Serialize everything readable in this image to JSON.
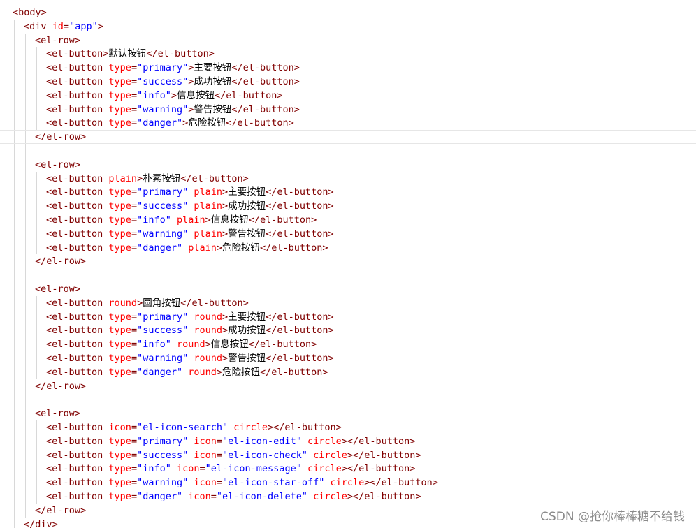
{
  "colors": {
    "tag": "#800000",
    "attr_name": "#ff0000",
    "attr_value": "#0000ff",
    "text": "#000000",
    "punct": "#800000",
    "guide": "#d8d8d8"
  },
  "code_lines": [
    {
      "indent": 0,
      "tokens": [
        {
          "t": "tag",
          "v": "<body>"
        }
      ]
    },
    {
      "indent": 1,
      "tokens": [
        {
          "t": "tag",
          "v": "<div"
        },
        {
          "t": "text",
          "v": " "
        },
        {
          "t": "attr_name",
          "v": "id"
        },
        {
          "t": "punct",
          "v": "="
        },
        {
          "t": "attr_value",
          "v": "\"app\""
        },
        {
          "t": "tag",
          "v": ">"
        }
      ]
    },
    {
      "indent": 2,
      "tokens": [
        {
          "t": "tag",
          "v": "<el-row>"
        }
      ]
    },
    {
      "indent": 3,
      "tokens": [
        {
          "t": "tag",
          "v": "<el-button>"
        },
        {
          "t": "text",
          "v": "默认按钮"
        },
        {
          "t": "tag",
          "v": "</el-button>"
        }
      ]
    },
    {
      "indent": 3,
      "tokens": [
        {
          "t": "tag",
          "v": "<el-button"
        },
        {
          "t": "text",
          "v": " "
        },
        {
          "t": "attr_name",
          "v": "type"
        },
        {
          "t": "punct",
          "v": "="
        },
        {
          "t": "attr_value",
          "v": "\"primary\""
        },
        {
          "t": "tag",
          "v": ">"
        },
        {
          "t": "text",
          "v": "主要按钮"
        },
        {
          "t": "tag",
          "v": "</el-button>"
        }
      ]
    },
    {
      "indent": 3,
      "tokens": [
        {
          "t": "tag",
          "v": "<el-button"
        },
        {
          "t": "text",
          "v": " "
        },
        {
          "t": "attr_name",
          "v": "type"
        },
        {
          "t": "punct",
          "v": "="
        },
        {
          "t": "attr_value",
          "v": "\"success\""
        },
        {
          "t": "tag",
          "v": ">"
        },
        {
          "t": "text",
          "v": "成功按钮"
        },
        {
          "t": "tag",
          "v": "</el-button>"
        }
      ]
    },
    {
      "indent": 3,
      "tokens": [
        {
          "t": "tag",
          "v": "<el-button"
        },
        {
          "t": "text",
          "v": " "
        },
        {
          "t": "attr_name",
          "v": "type"
        },
        {
          "t": "punct",
          "v": "="
        },
        {
          "t": "attr_value",
          "v": "\"info\""
        },
        {
          "t": "tag",
          "v": ">"
        },
        {
          "t": "text",
          "v": "信息按钮"
        },
        {
          "t": "tag",
          "v": "</el-button>"
        }
      ]
    },
    {
      "indent": 3,
      "tokens": [
        {
          "t": "tag",
          "v": "<el-button"
        },
        {
          "t": "text",
          "v": " "
        },
        {
          "t": "attr_name",
          "v": "type"
        },
        {
          "t": "punct",
          "v": "="
        },
        {
          "t": "attr_value",
          "v": "\"warning\""
        },
        {
          "t": "tag",
          "v": ">"
        },
        {
          "t": "text",
          "v": "警告按钮"
        },
        {
          "t": "tag",
          "v": "</el-button>"
        }
      ]
    },
    {
      "indent": 3,
      "tokens": [
        {
          "t": "tag",
          "v": "<el-button"
        },
        {
          "t": "text",
          "v": " "
        },
        {
          "t": "attr_name",
          "v": "type"
        },
        {
          "t": "punct",
          "v": "="
        },
        {
          "t": "attr_value",
          "v": "\"danger\""
        },
        {
          "t": "tag",
          "v": ">"
        },
        {
          "t": "text",
          "v": "危险按钮"
        },
        {
          "t": "tag",
          "v": "</el-button>"
        }
      ]
    },
    {
      "indent": 2,
      "current": true,
      "tokens": [
        {
          "t": "tag",
          "v": "</el-row>"
        }
      ]
    },
    {
      "indent": 2,
      "tokens": []
    },
    {
      "indent": 2,
      "tokens": [
        {
          "t": "tag",
          "v": "<el-row>"
        }
      ]
    },
    {
      "indent": 3,
      "tokens": [
        {
          "t": "tag",
          "v": "<el-button"
        },
        {
          "t": "text",
          "v": " "
        },
        {
          "t": "attr_name",
          "v": "plain"
        },
        {
          "t": "tag",
          "v": ">"
        },
        {
          "t": "text",
          "v": "朴素按钮"
        },
        {
          "t": "tag",
          "v": "</el-button>"
        }
      ]
    },
    {
      "indent": 3,
      "tokens": [
        {
          "t": "tag",
          "v": "<el-button"
        },
        {
          "t": "text",
          "v": " "
        },
        {
          "t": "attr_name",
          "v": "type"
        },
        {
          "t": "punct",
          "v": "="
        },
        {
          "t": "attr_value",
          "v": "\"primary\""
        },
        {
          "t": "text",
          "v": " "
        },
        {
          "t": "attr_name",
          "v": "plain"
        },
        {
          "t": "tag",
          "v": ">"
        },
        {
          "t": "text",
          "v": "主要按钮"
        },
        {
          "t": "tag",
          "v": "</el-button>"
        }
      ]
    },
    {
      "indent": 3,
      "tokens": [
        {
          "t": "tag",
          "v": "<el-button"
        },
        {
          "t": "text",
          "v": " "
        },
        {
          "t": "attr_name",
          "v": "type"
        },
        {
          "t": "punct",
          "v": "="
        },
        {
          "t": "attr_value",
          "v": "\"success\""
        },
        {
          "t": "text",
          "v": " "
        },
        {
          "t": "attr_name",
          "v": "plain"
        },
        {
          "t": "tag",
          "v": ">"
        },
        {
          "t": "text",
          "v": "成功按钮"
        },
        {
          "t": "tag",
          "v": "</el-button>"
        }
      ]
    },
    {
      "indent": 3,
      "tokens": [
        {
          "t": "tag",
          "v": "<el-button"
        },
        {
          "t": "text",
          "v": " "
        },
        {
          "t": "attr_name",
          "v": "type"
        },
        {
          "t": "punct",
          "v": "="
        },
        {
          "t": "attr_value",
          "v": "\"info\""
        },
        {
          "t": "text",
          "v": " "
        },
        {
          "t": "attr_name",
          "v": "plain"
        },
        {
          "t": "tag",
          "v": ">"
        },
        {
          "t": "text",
          "v": "信息按钮"
        },
        {
          "t": "tag",
          "v": "</el-button>"
        }
      ]
    },
    {
      "indent": 3,
      "tokens": [
        {
          "t": "tag",
          "v": "<el-button"
        },
        {
          "t": "text",
          "v": " "
        },
        {
          "t": "attr_name",
          "v": "type"
        },
        {
          "t": "punct",
          "v": "="
        },
        {
          "t": "attr_value",
          "v": "\"warning\""
        },
        {
          "t": "text",
          "v": " "
        },
        {
          "t": "attr_name",
          "v": "plain"
        },
        {
          "t": "tag",
          "v": ">"
        },
        {
          "t": "text",
          "v": "警告按钮"
        },
        {
          "t": "tag",
          "v": "</el-button>"
        }
      ]
    },
    {
      "indent": 3,
      "tokens": [
        {
          "t": "tag",
          "v": "<el-button"
        },
        {
          "t": "text",
          "v": " "
        },
        {
          "t": "attr_name",
          "v": "type"
        },
        {
          "t": "punct",
          "v": "="
        },
        {
          "t": "attr_value",
          "v": "\"danger\""
        },
        {
          "t": "text",
          "v": " "
        },
        {
          "t": "attr_name",
          "v": "plain"
        },
        {
          "t": "tag",
          "v": ">"
        },
        {
          "t": "text",
          "v": "危险按钮"
        },
        {
          "t": "tag",
          "v": "</el-button>"
        }
      ]
    },
    {
      "indent": 2,
      "tokens": [
        {
          "t": "tag",
          "v": "</el-row>"
        }
      ]
    },
    {
      "indent": 2,
      "tokens": []
    },
    {
      "indent": 2,
      "tokens": [
        {
          "t": "tag",
          "v": "<el-row>"
        }
      ]
    },
    {
      "indent": 3,
      "tokens": [
        {
          "t": "tag",
          "v": "<el-button"
        },
        {
          "t": "text",
          "v": " "
        },
        {
          "t": "attr_name",
          "v": "round"
        },
        {
          "t": "tag",
          "v": ">"
        },
        {
          "t": "text",
          "v": "圆角按钮"
        },
        {
          "t": "tag",
          "v": "</el-button>"
        }
      ]
    },
    {
      "indent": 3,
      "tokens": [
        {
          "t": "tag",
          "v": "<el-button"
        },
        {
          "t": "text",
          "v": " "
        },
        {
          "t": "attr_name",
          "v": "type"
        },
        {
          "t": "punct",
          "v": "="
        },
        {
          "t": "attr_value",
          "v": "\"primary\""
        },
        {
          "t": "text",
          "v": " "
        },
        {
          "t": "attr_name",
          "v": "round"
        },
        {
          "t": "tag",
          "v": ">"
        },
        {
          "t": "text",
          "v": "主要按钮"
        },
        {
          "t": "tag",
          "v": "</el-button>"
        }
      ]
    },
    {
      "indent": 3,
      "tokens": [
        {
          "t": "tag",
          "v": "<el-button"
        },
        {
          "t": "text",
          "v": " "
        },
        {
          "t": "attr_name",
          "v": "type"
        },
        {
          "t": "punct",
          "v": "="
        },
        {
          "t": "attr_value",
          "v": "\"success\""
        },
        {
          "t": "text",
          "v": " "
        },
        {
          "t": "attr_name",
          "v": "round"
        },
        {
          "t": "tag",
          "v": ">"
        },
        {
          "t": "text",
          "v": "成功按钮"
        },
        {
          "t": "tag",
          "v": "</el-button>"
        }
      ]
    },
    {
      "indent": 3,
      "tokens": [
        {
          "t": "tag",
          "v": "<el-button"
        },
        {
          "t": "text",
          "v": " "
        },
        {
          "t": "attr_name",
          "v": "type"
        },
        {
          "t": "punct",
          "v": "="
        },
        {
          "t": "attr_value",
          "v": "\"info\""
        },
        {
          "t": "text",
          "v": " "
        },
        {
          "t": "attr_name",
          "v": "round"
        },
        {
          "t": "tag",
          "v": ">"
        },
        {
          "t": "text",
          "v": "信息按钮"
        },
        {
          "t": "tag",
          "v": "</el-button>"
        }
      ]
    },
    {
      "indent": 3,
      "tokens": [
        {
          "t": "tag",
          "v": "<el-button"
        },
        {
          "t": "text",
          "v": " "
        },
        {
          "t": "attr_name",
          "v": "type"
        },
        {
          "t": "punct",
          "v": "="
        },
        {
          "t": "attr_value",
          "v": "\"warning\""
        },
        {
          "t": "text",
          "v": " "
        },
        {
          "t": "attr_name",
          "v": "round"
        },
        {
          "t": "tag",
          "v": ">"
        },
        {
          "t": "text",
          "v": "警告按钮"
        },
        {
          "t": "tag",
          "v": "</el-button>"
        }
      ]
    },
    {
      "indent": 3,
      "tokens": [
        {
          "t": "tag",
          "v": "<el-button"
        },
        {
          "t": "text",
          "v": " "
        },
        {
          "t": "attr_name",
          "v": "type"
        },
        {
          "t": "punct",
          "v": "="
        },
        {
          "t": "attr_value",
          "v": "\"danger\""
        },
        {
          "t": "text",
          "v": " "
        },
        {
          "t": "attr_name",
          "v": "round"
        },
        {
          "t": "tag",
          "v": ">"
        },
        {
          "t": "text",
          "v": "危险按钮"
        },
        {
          "t": "tag",
          "v": "</el-button>"
        }
      ]
    },
    {
      "indent": 2,
      "tokens": [
        {
          "t": "tag",
          "v": "</el-row>"
        }
      ]
    },
    {
      "indent": 2,
      "tokens": []
    },
    {
      "indent": 2,
      "tokens": [
        {
          "t": "tag",
          "v": "<el-row>"
        }
      ]
    },
    {
      "indent": 3,
      "tokens": [
        {
          "t": "tag",
          "v": "<el-button"
        },
        {
          "t": "text",
          "v": " "
        },
        {
          "t": "attr_name",
          "v": "icon"
        },
        {
          "t": "punct",
          "v": "="
        },
        {
          "t": "attr_value",
          "v": "\"el-icon-search\""
        },
        {
          "t": "text",
          "v": " "
        },
        {
          "t": "attr_name",
          "v": "circle"
        },
        {
          "t": "tag",
          "v": "></el-button>"
        }
      ]
    },
    {
      "indent": 3,
      "tokens": [
        {
          "t": "tag",
          "v": "<el-button"
        },
        {
          "t": "text",
          "v": " "
        },
        {
          "t": "attr_name",
          "v": "type"
        },
        {
          "t": "punct",
          "v": "="
        },
        {
          "t": "attr_value",
          "v": "\"primary\""
        },
        {
          "t": "text",
          "v": " "
        },
        {
          "t": "attr_name",
          "v": "icon"
        },
        {
          "t": "punct",
          "v": "="
        },
        {
          "t": "attr_value",
          "v": "\"el-icon-edit\""
        },
        {
          "t": "text",
          "v": " "
        },
        {
          "t": "attr_name",
          "v": "circle"
        },
        {
          "t": "tag",
          "v": "></el-button>"
        }
      ]
    },
    {
      "indent": 3,
      "tokens": [
        {
          "t": "tag",
          "v": "<el-button"
        },
        {
          "t": "text",
          "v": " "
        },
        {
          "t": "attr_name",
          "v": "type"
        },
        {
          "t": "punct",
          "v": "="
        },
        {
          "t": "attr_value",
          "v": "\"success\""
        },
        {
          "t": "text",
          "v": " "
        },
        {
          "t": "attr_name",
          "v": "icon"
        },
        {
          "t": "punct",
          "v": "="
        },
        {
          "t": "attr_value",
          "v": "\"el-icon-check\""
        },
        {
          "t": "text",
          "v": " "
        },
        {
          "t": "attr_name",
          "v": "circle"
        },
        {
          "t": "tag",
          "v": "></el-button>"
        }
      ]
    },
    {
      "indent": 3,
      "tokens": [
        {
          "t": "tag",
          "v": "<el-button"
        },
        {
          "t": "text",
          "v": " "
        },
        {
          "t": "attr_name",
          "v": "type"
        },
        {
          "t": "punct",
          "v": "="
        },
        {
          "t": "attr_value",
          "v": "\"info\""
        },
        {
          "t": "text",
          "v": " "
        },
        {
          "t": "attr_name",
          "v": "icon"
        },
        {
          "t": "punct",
          "v": "="
        },
        {
          "t": "attr_value",
          "v": "\"el-icon-message\""
        },
        {
          "t": "text",
          "v": " "
        },
        {
          "t": "attr_name",
          "v": "circle"
        },
        {
          "t": "tag",
          "v": "></el-button>"
        }
      ]
    },
    {
      "indent": 3,
      "tokens": [
        {
          "t": "tag",
          "v": "<el-button"
        },
        {
          "t": "text",
          "v": " "
        },
        {
          "t": "attr_name",
          "v": "type"
        },
        {
          "t": "punct",
          "v": "="
        },
        {
          "t": "attr_value",
          "v": "\"warning\""
        },
        {
          "t": "text",
          "v": " "
        },
        {
          "t": "attr_name",
          "v": "icon"
        },
        {
          "t": "punct",
          "v": "="
        },
        {
          "t": "attr_value",
          "v": "\"el-icon-star-off\""
        },
        {
          "t": "text",
          "v": " "
        },
        {
          "t": "attr_name",
          "v": "circle"
        },
        {
          "t": "tag",
          "v": "></el-button>"
        }
      ]
    },
    {
      "indent": 3,
      "tokens": [
        {
          "t": "tag",
          "v": "<el-button"
        },
        {
          "t": "text",
          "v": " "
        },
        {
          "t": "attr_name",
          "v": "type"
        },
        {
          "t": "punct",
          "v": "="
        },
        {
          "t": "attr_value",
          "v": "\"danger\""
        },
        {
          "t": "text",
          "v": " "
        },
        {
          "t": "attr_name",
          "v": "icon"
        },
        {
          "t": "punct",
          "v": "="
        },
        {
          "t": "attr_value",
          "v": "\"el-icon-delete\""
        },
        {
          "t": "text",
          "v": " "
        },
        {
          "t": "attr_name",
          "v": "circle"
        },
        {
          "t": "tag",
          "v": "></el-button>"
        }
      ]
    },
    {
      "indent": 2,
      "tokens": [
        {
          "t": "tag",
          "v": "</el-row>"
        }
      ]
    },
    {
      "indent": 1,
      "tokens": [
        {
          "t": "tag",
          "v": "</div>"
        }
      ]
    }
  ],
  "watermark": "CSDN @抢你棒棒糖不给钱"
}
